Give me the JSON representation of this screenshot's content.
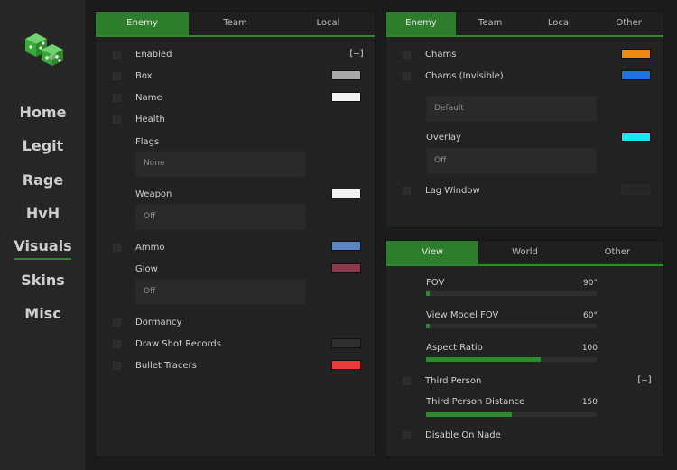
{
  "nav": {
    "items": [
      "Home",
      "Legit",
      "Rage",
      "HvH",
      "Visuals",
      "Skins",
      "Misc"
    ],
    "active": "Visuals"
  },
  "esp_panel": {
    "tabs": [
      "Enemy",
      "Team",
      "Local"
    ],
    "active_tab": "Enemy",
    "enabled": "Enabled",
    "enabled_key": "[–]",
    "box": "Box",
    "name": "Name",
    "health": "Health",
    "flags": "Flags",
    "flags_value": "None",
    "weapon": "Weapon",
    "weapon_value": "Off",
    "ammo": "Ammo",
    "glow": "Glow",
    "glow_value": "Off",
    "dormancy": "Dormancy",
    "draw_shot_records": "Draw Shot Records",
    "bullet_tracers": "Bullet Tracers"
  },
  "chams_panel": {
    "tabs": [
      "Enemy",
      "Team",
      "Local",
      "Other"
    ],
    "active_tab": "Enemy",
    "chams": "Chams",
    "chams_invisible": "Chams (Invisible)",
    "material_value": "Default",
    "overlay": "Overlay",
    "overlay_value": "Off",
    "lag_window": "Lag Window"
  },
  "view_panel": {
    "tabs": [
      "View",
      "World",
      "Other"
    ],
    "active_tab": "View",
    "fov": "FOV",
    "fov_value": "90°",
    "fov_level": 0,
    "view_model_fov": "View Model FOV",
    "view_model_fov_value": "60°",
    "view_model_fov_level": 0,
    "aspect_ratio": "Aspect Ratio",
    "aspect_ratio_value": "100",
    "aspect_ratio_level": 0.67,
    "third_person": "Third Person",
    "third_person_key": "[–]",
    "third_person_distance": "Third Person Distance",
    "third_person_distance_value": "150",
    "third_person_distance_level": 0.5,
    "disable_on_nade": "Disable On Nade"
  },
  "colors": {
    "accent": "#2d8a2d",
    "box": "#a8a8a8",
    "name": "#f2f2f2",
    "weapon": "#f2f2f2",
    "ammo": "#5a86c4",
    "glow": "#8a3a4a",
    "draw_shot_records": "#2f2f2f",
    "bullet_tracers": "#ec3a3a",
    "chams": "#f08a14",
    "chams_invisible": "#1e72e8",
    "overlay": "#17e6f4",
    "lag_window": "#262626"
  }
}
